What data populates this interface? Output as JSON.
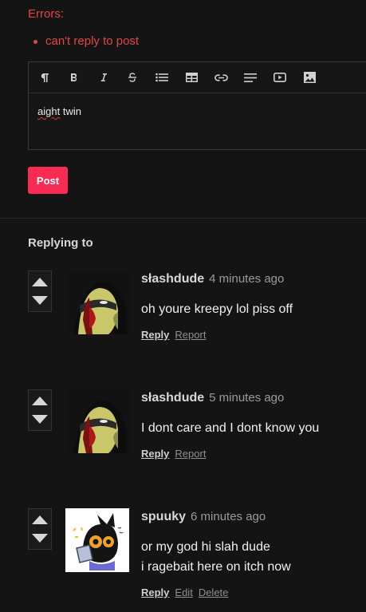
{
  "errors": {
    "title": "Errors:",
    "items": [
      "can't reply to post"
    ]
  },
  "editor": {
    "toolbar": [
      "pilcrow-icon",
      "bold-icon",
      "italic-icon",
      "strikethrough-icon",
      "bullet-list-icon",
      "table-icon",
      "link-icon",
      "align-icon",
      "video-icon",
      "image-icon"
    ],
    "text_word1": "aight",
    "text_word2": "twin"
  },
  "post_button": "Post",
  "replying_to": "Replying to",
  "comments": [
    {
      "user": "słashdude",
      "time": "4 minutes ago",
      "body": [
        "oh youre kreepy lol piss off"
      ],
      "actions": [
        "Reply",
        "Report"
      ]
    },
    {
      "user": "słashdude",
      "time": "5 minutes ago",
      "body": [
        "I dont care and I dont know you"
      ],
      "actions": [
        "Reply",
        "Report"
      ]
    },
    {
      "user": "spuuky",
      "time": "6 minutes ago",
      "body": [
        "or my god hi slah dude",
        "i ragebait here on itch now"
      ],
      "actions": [
        "Reply",
        "Edit",
        "Delete"
      ]
    }
  ],
  "colors": {
    "background": "#141414",
    "error": "#e04545",
    "accent": "#fa2c53"
  }
}
